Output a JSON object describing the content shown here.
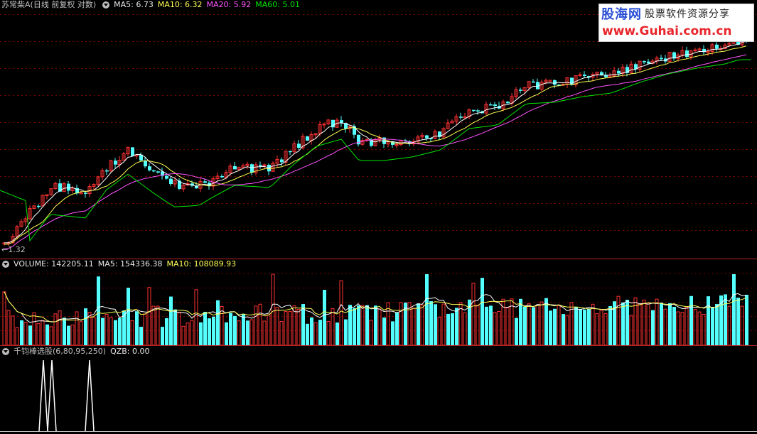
{
  "price_pane": {
    "stock_name": "苏常柴A",
    "mode": "(日线 前复权 对数)",
    "ma5": "MA5: 6.73",
    "ma10": "MA10: 6.32",
    "ma20": "MA20: 5.92",
    "ma60": "MA60: 5.01",
    "low_marker": "1.32"
  },
  "volume_pane": {
    "title": "VOLUME: 142205.11",
    "ma5": "MA5: 154336.38",
    "ma10": "MA10: 108089.93"
  },
  "indicator_pane": {
    "name": "千钧棒选股",
    "params": "(6,80,95,250)",
    "value": "QZB: 0.00"
  },
  "watermark": {
    "logo": "股海网",
    "slogan": "股票软件资源分享",
    "url": "www.Guhai.com.cn"
  },
  "colors": {
    "background": "#000000",
    "up_candle": "#ff3232",
    "down_candle": "#54ffff",
    "ma5": "#ffffff",
    "ma10": "#ffff54",
    "ma20": "#ff54ff",
    "ma60": "#00e600",
    "grid": "#7a0000",
    "separator": "#b22222"
  },
  "chart_data": {
    "type": "candlestick",
    "scale": "log",
    "indicator_peaks": 3
  }
}
